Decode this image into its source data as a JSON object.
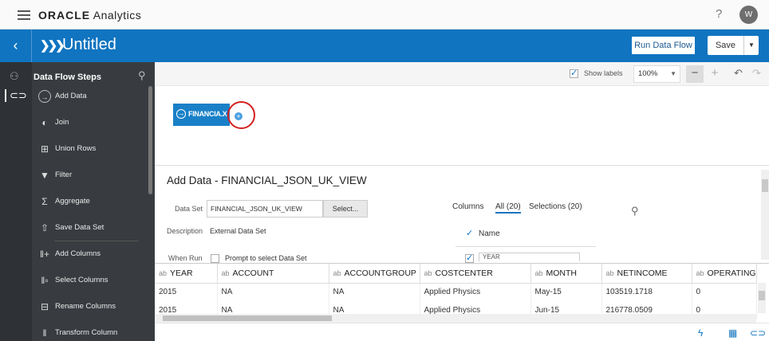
{
  "topbar": {
    "logo_brand": "ORACLE",
    "logo_product": " Analytics",
    "help": "?",
    "avatar": "W"
  },
  "header": {
    "back_icon": "chevron-left-icon",
    "dataflow_icon": "dataflow-icon",
    "title": "Untitled",
    "run_label": "Run Data Flow",
    "save_label": "Save"
  },
  "steps": {
    "title": "Data Flow Steps",
    "items": [
      {
        "label": "Add Data",
        "icon": "add-data-icon"
      },
      {
        "label": "Join",
        "icon": "join-icon"
      },
      {
        "label": "Union Rows",
        "icon": "union-rows-icon"
      },
      {
        "label": "Filter",
        "icon": "filter-icon"
      },
      {
        "label": "Aggregate",
        "icon": "sigma-icon"
      },
      {
        "label": "Save Data Set",
        "icon": "save-data-set-icon"
      },
      {
        "label": "Add Columns",
        "icon": "add-columns-icon"
      },
      {
        "label": "Select Columns",
        "icon": "select-columns-icon"
      },
      {
        "label": "Rename Columns",
        "icon": "rename-columns-icon"
      },
      {
        "label": "Transform Column",
        "icon": "transform-column-icon"
      }
    ]
  },
  "toolbar": {
    "show_labels": "Show labels",
    "zoom": "100%"
  },
  "canvas": {
    "node_label": "FINANCIA.X"
  },
  "details": {
    "title": "Add Data - FINANCIAL_JSON_UK_VIEW",
    "dataset_label": "Data Set",
    "dataset_value": "FINANCIAL_JSON_UK_VIEW",
    "select_button": "Select...",
    "description_label": "Description",
    "description_value": "External Data Set",
    "whenrun_label": "When Run",
    "prompt_label": "Prompt to select Data Set",
    "columns_label": "Columns",
    "tab_all": "All (20)",
    "tab_selections": "Selections (20)",
    "name_label": "Name",
    "partial_field": "YEAR"
  },
  "table": {
    "type_prefix": "ab",
    "headers": [
      "YEAR",
      "ACCOUNT",
      "ACCOUNTGROUP",
      "COSTCENTER",
      "MONTH",
      "NETINCOME",
      "OPERATING"
    ],
    "rows": [
      [
        "2015",
        "NA",
        "NA",
        "Applied Physics",
        "May-15",
        "103519.1718",
        "0"
      ],
      [
        "2015",
        "NA",
        "NA",
        "Applied Physics",
        "Jun-15",
        "216778.0509",
        "0"
      ]
    ]
  }
}
